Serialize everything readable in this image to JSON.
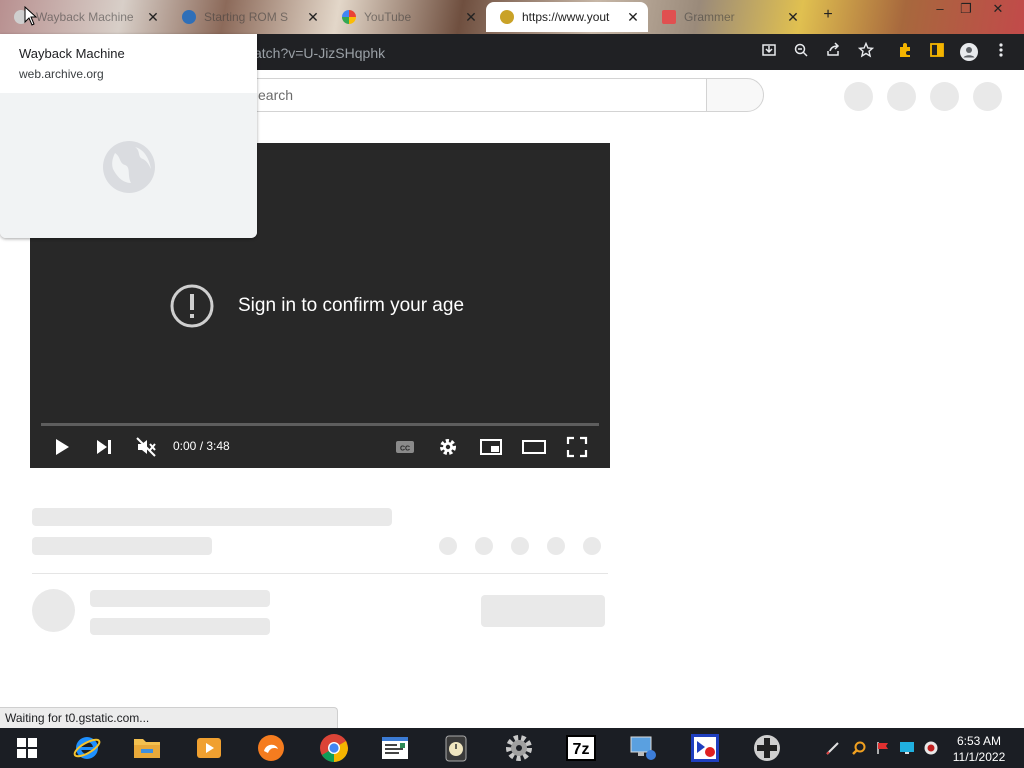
{
  "browser": {
    "tabs": [
      {
        "title": "Wayback Machine",
        "active": false
      },
      {
        "title": "Starting ROM S",
        "active": false
      },
      {
        "title": "YouTube",
        "active": false
      },
      {
        "title": "https://www.yout",
        "active": true
      },
      {
        "title": "Grammer",
        "active": false
      }
    ],
    "url": "/watch?v=U-JizSHqphk",
    "status_text": "Waiting for t0.gstatic.com...",
    "hover_card": {
      "title": "Wayback Machine",
      "url": "web.archive.org"
    },
    "icons": [
      "install-icon",
      "zoom-icon",
      "share-icon",
      "bookmark-star-icon",
      "extensions-icon",
      "side-panel-icon",
      "profile-icon",
      "menu-icon"
    ]
  },
  "youtube": {
    "search_placeholder": "earch",
    "player": {
      "message": "Sign in to confirm your age",
      "time": "0:00 / 3:48",
      "progress": 0
    }
  },
  "taskbar": {
    "time": "6:53 AM",
    "date": "11/1/2022"
  },
  "colors": {
    "toolbar": "#202124",
    "player_bg": "#282828",
    "taskbar": "#1b1e24",
    "skeleton": "#e9e9e9"
  }
}
